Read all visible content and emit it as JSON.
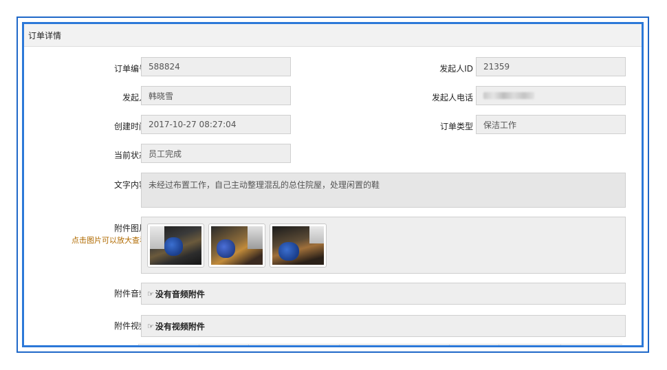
{
  "panel": {
    "title": "订单详情"
  },
  "fields": {
    "order_id": {
      "label": "订单编号",
      "value": "588824"
    },
    "initiator_id": {
      "label": "发起人ID",
      "value": "21359"
    },
    "initiator": {
      "label": "发起人",
      "value": "韩晓雪"
    },
    "initiator_phone": {
      "label": "发起人电话",
      "value": ""
    },
    "created_time": {
      "label": "创建时间",
      "value": "2017-10-27 08:27:04"
    },
    "order_type": {
      "label": "订单类型",
      "value": "保洁工作"
    },
    "current_status": {
      "label": "当前状态",
      "value": "员工完成"
    },
    "text_content": {
      "label": "文字内容",
      "value": "未经过布置工作，自己主动整理混乱的总住院屋，处理闲置的鞋"
    }
  },
  "attachments": {
    "images_label": "附件图片",
    "images_hint": "点击图片可以放大查看",
    "image_count": 3,
    "audio_label": "附件音频",
    "audio_value": "没有音频附件",
    "video_label": "附件视频",
    "video_value": "没有视频附件"
  },
  "icons": {
    "hand": "hand-pointing-icon"
  }
}
